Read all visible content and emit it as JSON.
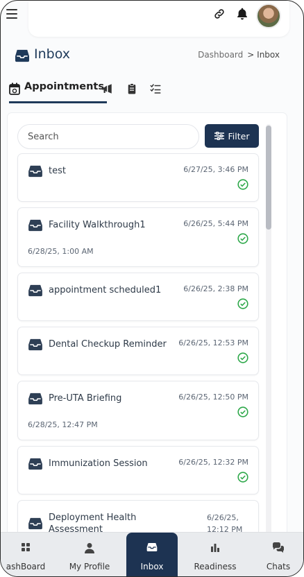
{
  "header": {
    "menu_icon": "hamburger-icon",
    "link_icon": "link-icon",
    "notification_icon": "bell-icon",
    "avatar": "user-avatar"
  },
  "page": {
    "title": "Inbox",
    "title_icon": "inbox-icon",
    "breadcrumb": {
      "parent": "Dashboard",
      "separator": ">",
      "current": "Inbox"
    }
  },
  "tabs": [
    {
      "label": "Appointments",
      "icon": "calendar-icon",
      "active": true
    },
    {
      "label": "",
      "icon": "megaphone-icon",
      "active": false
    },
    {
      "label": "",
      "icon": "clipboard-icon",
      "active": false
    },
    {
      "label": "",
      "icon": "checklist-icon",
      "active": false
    }
  ],
  "search": {
    "placeholder": "Search",
    "value": ""
  },
  "filter": {
    "label": "Filter",
    "icon": "sliders-icon"
  },
  "colors": {
    "primary": "#1d3352",
    "status_ok": "#2ea84a",
    "title": "#1f3a5a"
  },
  "items": [
    {
      "title": "test",
      "date": "6/27/25, 3:46 PM",
      "sub": "",
      "status": "check-circle-icon"
    },
    {
      "title": "Facility Walkthrough1",
      "date": "6/26/25, 5:44 PM",
      "sub": "6/28/25, 1:00 AM",
      "status": "check-circle-icon"
    },
    {
      "title": "appointment scheduled1",
      "date": "6/26/25, 2:38 PM",
      "sub": "",
      "status": "check-circle-icon"
    },
    {
      "title": "Dental Checkup Reminder",
      "date": "6/26/25, 12:53 PM",
      "sub": "",
      "status": "check-circle-icon"
    },
    {
      "title": "Pre-UTA Briefing",
      "date": "6/26/25, 12:50 PM",
      "sub": "6/28/25, 12:47 PM",
      "status": "check-circle-icon"
    },
    {
      "title": "Immunization Session",
      "date": "6/26/25, 12:32 PM",
      "sub": "",
      "status": "check-circle-icon"
    },
    {
      "title": "Deployment Health Assessment",
      "date": "6/26/25, 12:12 PM",
      "sub": "",
      "status": ""
    }
  ],
  "bottom_nav": [
    {
      "label": "ashBoard",
      "icon": "grid-icon",
      "active": false
    },
    {
      "label": "My Profile",
      "icon": "person-icon",
      "active": false
    },
    {
      "label": "Inbox",
      "icon": "inbox-icon",
      "active": true
    },
    {
      "label": "Readiness",
      "icon": "bar-chart-icon",
      "active": false
    },
    {
      "label": "Chats",
      "icon": "chat-bubbles-icon",
      "active": false
    }
  ]
}
